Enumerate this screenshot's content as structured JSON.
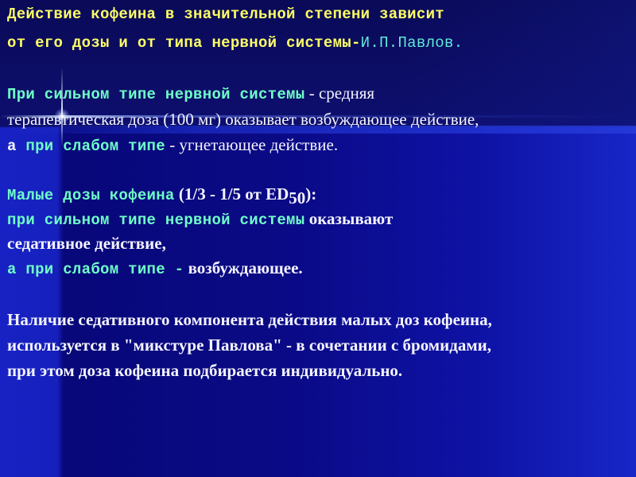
{
  "slide": {
    "colors": {
      "background_dark": "#0c0c66",
      "background_bright": "#1822c4",
      "heading_text": "#ffff66",
      "highlight_text": "#6fffc8",
      "body_text": "#f4f4ff",
      "author_text": "#5fe8d8"
    },
    "heading": {
      "line1": "Действие кофеина в значительной степени зависит",
      "line2_prefix": "от его дозы и от типа нервной системы-",
      "author": "И.П.Павлов",
      "line2_suffix": "."
    },
    "paragraph1": {
      "line1_highlight": "При сильном типе нервной системы",
      "line1_rest": " - средняя",
      "line2": "терапевтическая доза (100 мг) оказывает возбуждающее действие,",
      "line3_a": "а ",
      "line3_highlight": "при слабом типе",
      "line3_rest": " - угнетающее действие."
    },
    "paragraph2": {
      "line1_highlight": "Малые дозы кофеина",
      "line1_rest": " (1/3 - 1/5 от ED",
      "line1_sub": "50",
      "line1_end": "):",
      "line2_highlight": "при сильном типе нервной системы",
      "line2_rest": " оказывают",
      "line3": "седативное действие,",
      "line4_highlight": "а при слабом типе -",
      "line4_rest": " возбуждающее."
    },
    "paragraph3": {
      "line1": "Наличие седативного компонента действия малых доз кофеина,",
      "line2": "используется в \"микстуре Павлова\" - в сочетании с бромидами,",
      "line3": "при этом доза кофеина подбирается индивидуально."
    }
  }
}
